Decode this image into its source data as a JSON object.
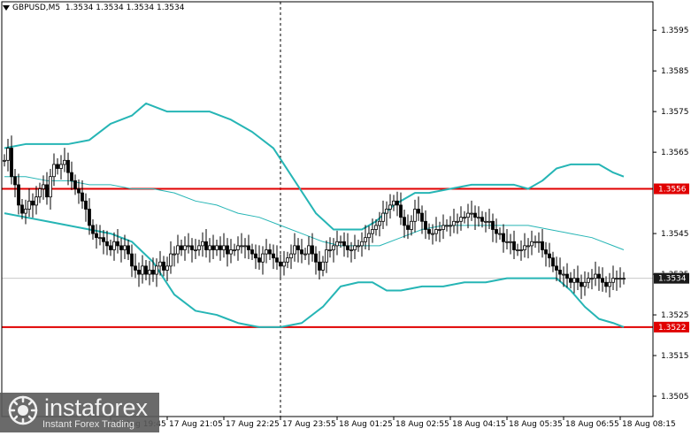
{
  "window": {
    "symbol": "GBPUSD,M5",
    "ohlc": "1.3534 1.3534 1.3534 1.3534"
  },
  "colors": {
    "background": "#ffffff",
    "grid": "#c8c8c8",
    "candle": "#000000",
    "bollinger": "#26b5b5",
    "level_line": "#e00000",
    "axis": "#000000"
  },
  "branding": {
    "name": "instaforex",
    "tagline": "Instant Forex Trading"
  },
  "chart_data": {
    "type": "candlestick",
    "title": "",
    "ylim": [
      1.35,
      1.3602
    ],
    "y_ticks": [
      "1.3595",
      "1.3585",
      "1.3575",
      "1.3565",
      "1.3545",
      "1.3535",
      "1.3525",
      "1.3515",
      "1.3505"
    ],
    "x_ticks": [
      "17 Aug 19:45",
      "17 Aug 21:05",
      "17 Aug 22:25",
      "17 Aug 23:55",
      "18 Aug 01:25",
      "18 Aug 02:55",
      "18 Aug 04:15",
      "18 Aug 05:35",
      "18 Aug 06:55",
      "18 Aug 08:15"
    ],
    "x_tick_indices": [
      30,
      46,
      62,
      78,
      94,
      110,
      126,
      142,
      158,
      174
    ],
    "price_labels": [
      {
        "value": 1.3556,
        "text": "1.3556",
        "style": "red"
      },
      {
        "value": 1.3534,
        "text": "1.3534",
        "style": "dark"
      },
      {
        "value": 1.3522,
        "text": "1.3522",
        "style": "red"
      }
    ],
    "horizontal_levels": [
      1.3556,
      1.3522
    ],
    "current_price": 1.3534,
    "vertical_marker_index": 78,
    "close": [
      1.3563,
      1.3566,
      1.3559,
      1.3557,
      1.3552,
      1.355,
      1.3551,
      1.3553,
      1.3552,
      1.3554,
      1.3556,
      1.3557,
      1.3554,
      1.3559,
      1.3562,
      1.3561,
      1.3562,
      1.3563,
      1.356,
      1.3558,
      1.3556,
      1.3555,
      1.3553,
      1.3551,
      1.3547,
      1.3545,
      1.3544,
      1.3544,
      1.3543,
      1.3542,
      1.3541,
      1.3543,
      1.3542,
      1.3541,
      1.3542,
      1.354,
      1.3537,
      1.3536,
      1.3535,
      1.3537,
      1.3535,
      1.3536,
      1.3535,
      1.3537,
      1.3538,
      1.3536,
      1.3537,
      1.354,
      1.354,
      1.3542,
      1.3541,
      1.3542,
      1.3542,
      1.3541,
      1.3541,
      1.3542,
      1.3543,
      1.3541,
      1.3542,
      1.3541,
      1.3542,
      1.3541,
      1.3542,
      1.354,
      1.3541,
      1.3541,
      1.3542,
      1.3542,
      1.3542,
      1.3541,
      1.354,
      1.3539,
      1.3538,
      1.354,
      1.3541,
      1.354,
      1.3539,
      1.3538,
      1.3537,
      1.3538,
      1.3539,
      1.354,
      1.3542,
      1.3541,
      1.354,
      1.354,
      1.3542,
      1.354,
      1.3538,
      1.3536,
      1.3538,
      1.3541,
      1.3541,
      1.3542,
      1.3543,
      1.3543,
      1.3542,
      1.3541,
      1.3541,
      1.3542,
      1.3542,
      1.3543,
      1.3544,
      1.3545,
      1.3546,
      1.3547,
      1.3548,
      1.355,
      1.3551,
      1.3552,
      1.3553,
      1.3552,
      1.3549,
      1.3547,
      1.3546,
      1.3548,
      1.3551,
      1.355,
      1.3548,
      1.3546,
      1.3545,
      1.3545,
      1.3546,
      1.3546,
      1.3547,
      1.3547,
      1.3547,
      1.3548,
      1.3548,
      1.3549,
      1.3549,
      1.355,
      1.355,
      1.3549,
      1.3549,
      1.3548,
      1.3548,
      1.3548,
      1.3546,
      1.3545,
      1.3545,
      1.3543,
      1.3543,
      1.3543,
      1.3541,
      1.3541,
      1.3541,
      1.3542,
      1.3542,
      1.3543,
      1.3543,
      1.3543,
      1.3541,
      1.354,
      1.3539,
      1.3537,
      1.3536,
      1.3535,
      1.3535,
      1.3534,
      1.3533,
      1.3534,
      1.3533,
      1.3532,
      1.3533,
      1.3534,
      1.3534,
      1.3535,
      1.3534,
      1.3533,
      1.3532,
      1.3533,
      1.3534,
      1.3534,
      1.3534,
      1.3534
    ],
    "bollinger": {
      "upper": [
        [
          0,
          1.3566
        ],
        [
          6,
          1.3567
        ],
        [
          12,
          1.3567
        ],
        [
          18,
          1.3567
        ],
        [
          24,
          1.3568
        ],
        [
          30,
          1.3572
        ],
        [
          36,
          1.3574
        ],
        [
          40,
          1.3577
        ],
        [
          46,
          1.3575
        ],
        [
          52,
          1.3575
        ],
        [
          58,
          1.3575
        ],
        [
          64,
          1.3573
        ],
        [
          70,
          1.357
        ],
        [
          76,
          1.3566
        ],
        [
          82,
          1.3558
        ],
        [
          88,
          1.355
        ],
        [
          93,
          1.3546
        ],
        [
          97,
          1.3546
        ],
        [
          101,
          1.3546
        ],
        [
          105,
          1.3548
        ],
        [
          110,
          1.3552
        ],
        [
          116,
          1.3555
        ],
        [
          120,
          1.3555
        ],
        [
          126,
          1.3556
        ],
        [
          132,
          1.3557
        ],
        [
          138,
          1.3557
        ],
        [
          144,
          1.3557
        ],
        [
          148,
          1.3556
        ],
        [
          152,
          1.3558
        ],
        [
          156,
          1.3561
        ],
        [
          160,
          1.3562
        ],
        [
          164,
          1.3562
        ],
        [
          168,
          1.3562
        ],
        [
          172,
          1.356
        ],
        [
          175,
          1.3559
        ]
      ],
      "middle": [
        [
          0,
          1.3559
        ],
        [
          6,
          1.3559
        ],
        [
          12,
          1.3558
        ],
        [
          18,
          1.3558
        ],
        [
          24,
          1.3557
        ],
        [
          30,
          1.3557
        ],
        [
          36,
          1.3556
        ],
        [
          42,
          1.3556
        ],
        [
          48,
          1.3555
        ],
        [
          54,
          1.3553
        ],
        [
          60,
          1.3552
        ],
        [
          66,
          1.355
        ],
        [
          72,
          1.3549
        ],
        [
          78,
          1.3547
        ],
        [
          84,
          1.3545
        ],
        [
          90,
          1.3543
        ],
        [
          95,
          1.3542
        ],
        [
          100,
          1.3542
        ],
        [
          106,
          1.3542
        ],
        [
          112,
          1.3544
        ],
        [
          118,
          1.3546
        ],
        [
          124,
          1.3547
        ],
        [
          130,
          1.3547
        ],
        [
          136,
          1.3547
        ],
        [
          142,
          1.3547
        ],
        [
          148,
          1.3547
        ],
        [
          154,
          1.3546
        ],
        [
          160,
          1.3545
        ],
        [
          166,
          1.3544
        ],
        [
          172,
          1.3542
        ],
        [
          175,
          1.3541
        ]
      ],
      "lower": [
        [
          0,
          1.355
        ],
        [
          6,
          1.3549
        ],
        [
          12,
          1.3548
        ],
        [
          18,
          1.3547
        ],
        [
          24,
          1.3546
        ],
        [
          30,
          1.3545
        ],
        [
          36,
          1.3543
        ],
        [
          42,
          1.3538
        ],
        [
          48,
          1.353
        ],
        [
          54,
          1.3526
        ],
        [
          60,
          1.3525
        ],
        [
          66,
          1.3523
        ],
        [
          72,
          1.3522
        ],
        [
          78,
          1.3522
        ],
        [
          84,
          1.3523
        ],
        [
          90,
          1.3527
        ],
        [
          95,
          1.3532
        ],
        [
          100,
          1.3533
        ],
        [
          104,
          1.3533
        ],
        [
          108,
          1.3531
        ],
        [
          112,
          1.3531
        ],
        [
          118,
          1.3532
        ],
        [
          124,
          1.3532
        ],
        [
          130,
          1.3533
        ],
        [
          136,
          1.3533
        ],
        [
          142,
          1.3534
        ],
        [
          148,
          1.3534
        ],
        [
          152,
          1.3534
        ],
        [
          156,
          1.3534
        ],
        [
          160,
          1.3531
        ],
        [
          164,
          1.3527
        ],
        [
          168,
          1.3524
        ],
        [
          172,
          1.3523
        ],
        [
          175,
          1.3522
        ]
      ]
    }
  }
}
